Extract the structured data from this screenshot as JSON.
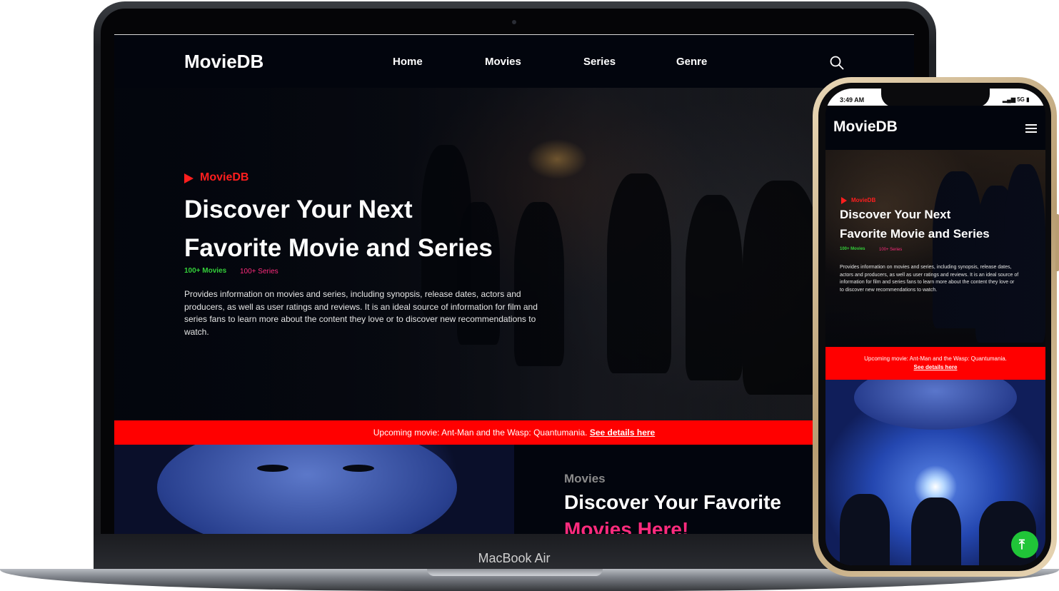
{
  "laptop": {
    "device_label": "MacBook Air",
    "nav": {
      "brand": "MovieDB",
      "links": [
        "Home",
        "Movies",
        "Series",
        "Genre"
      ]
    },
    "hero": {
      "tag": "MovieDB",
      "title_line1": "Discover Your Next",
      "title_line2": "Favorite Movie and Series",
      "stat_movies": "100+ Movies",
      "stat_series": "100+ Series",
      "description": "Provides information on movies and series, including synopsis, release dates, actors and producers, as well as user ratings and reviews. It is an ideal source of information for film and series fans to learn more about the content they love or to discover new recommendations to watch."
    },
    "banner": {
      "text": "Upcoming movie: Ant-Man and the Wasp: Quantumania.",
      "link": "See details here"
    },
    "section": {
      "label": "Movies",
      "title_white": "Discover Your Favorite",
      "title_pink": "Movies Here!"
    }
  },
  "phone": {
    "status": {
      "time": "3:49 AM",
      "network": "5G"
    },
    "nav": {
      "brand": "MovieDB"
    },
    "hero": {
      "tag": "MovieDB",
      "title_line1": "Discover Your Next",
      "title_line2": "Favorite Movie and Series",
      "stat_movies": "100+ Movies",
      "stat_series": "100+ Series",
      "description": "Provides information on movies and series, including synopsis, release dates, actors and producers, as well as user ratings and reviews. It is an ideal source of information for film and series fans to learn more about the content they love or to discover new recommendations to watch."
    },
    "banner": {
      "text": "Upcoming movie: Ant-Man and the Wasp: Quantumania.",
      "link": "See details here"
    }
  },
  "colors": {
    "accent_red": "#ff0000",
    "accent_pink": "#ff2b7d",
    "accent_green": "#34d03a",
    "background": "#02050d"
  },
  "icons": {
    "search": "search-icon",
    "play": "play-icon",
    "menu": "hamburger-menu-icon",
    "scroll_top": "arrow-up-icon"
  }
}
